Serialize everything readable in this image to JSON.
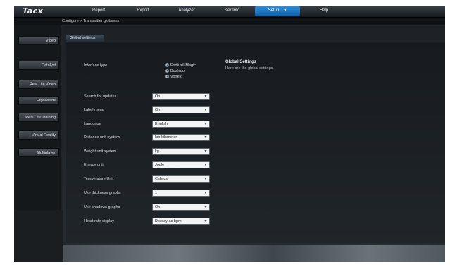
{
  "app": {
    "logo": "Tacx"
  },
  "menu": [
    {
      "label": "Report"
    },
    {
      "label": "Export"
    },
    {
      "label": "Analyzer"
    },
    {
      "label": "User Info"
    },
    {
      "label": "Setup",
      "active": true
    },
    {
      "label": "Help"
    }
  ],
  "breadcrumb": "Configure > Transmitter globsens",
  "sidebar": [
    {
      "label": "Video"
    },
    {
      "label": "Catalyst"
    },
    {
      "label": "Real Life Video"
    },
    {
      "label": "Ergo/Watts"
    },
    {
      "label": "Real Life Training"
    },
    {
      "label": "Virtual Reality"
    },
    {
      "label": "Multiplayer"
    }
  ],
  "tab": {
    "label": "Global settings"
  },
  "interface": {
    "label": "Interface type",
    "options": [
      {
        "label": "Fortius/i-Magic",
        "selected": true
      },
      {
        "label": "Bushido",
        "selected": false
      },
      {
        "label": "Vortex",
        "selected": false
      }
    ]
  },
  "settings": [
    {
      "label": "Search for updates",
      "value": "On"
    },
    {
      "label": "Label menu",
      "value": "On"
    },
    {
      "label": "Language",
      "value": "English"
    },
    {
      "label": "Distance unit system",
      "value": "km kilometer"
    },
    {
      "label": "Weight unit system",
      "value": "kg"
    },
    {
      "label": "Energy unit",
      "value": "Joule"
    },
    {
      "label": "Temperature Unit",
      "value": "Celsius"
    },
    {
      "label": "Use thickness graphs",
      "value": "1"
    },
    {
      "label": "Use shadows graphs",
      "value": "On"
    },
    {
      "label": "Heart rate display",
      "value": "Display as bpm"
    }
  ],
  "global_settings": {
    "title": "Global Settings",
    "description": "Here are the global settings"
  },
  "colors": {
    "accent": "#1f74bd",
    "background": "#202428",
    "input": "#f2f3f4"
  },
  "icons": {
    "dropdown": "chevron-down-icon",
    "radio": "radio-icon"
  }
}
